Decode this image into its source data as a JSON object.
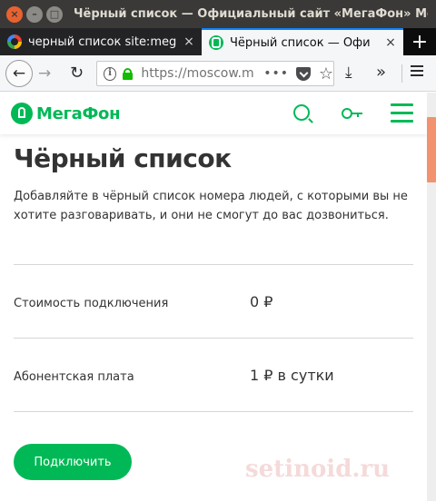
{
  "window": {
    "title": "Чёрный список — Официальный сайт «МегаФон» Мо",
    "close_glyph": "×",
    "minimize_glyph": "–",
    "maximize_glyph": "□"
  },
  "tabs": [
    {
      "label": "черный список site:meg",
      "favicon": "google-favicon",
      "close_glyph": "×",
      "active": false
    },
    {
      "label": "Чёрный список — Офи",
      "favicon": "megafon-favicon",
      "close_glyph": "×",
      "active": true
    }
  ],
  "new_tab_glyph": "+",
  "nav": {
    "back_glyph": "←",
    "forward_glyph": "→",
    "reload_glyph": "↻",
    "info_glyph": "i",
    "url": "https://moscow.m",
    "more_glyph": "•••",
    "star_glyph": "☆",
    "download_glyph": "⤓",
    "overflow_glyph": "»"
  },
  "site": {
    "logo_text": "МегаФон",
    "brand_color": "#00b956"
  },
  "main": {
    "title": "Чёрный список",
    "description": "Добавляйте в чёрный список номера людей, с которыми вы не хотите разговаривать, и они не смогут до вас дозвониться.",
    "rows": [
      {
        "label": "Стоимость подключения",
        "value": "0 ₽"
      },
      {
        "label": "Абонентская плата",
        "value": "1 ₽ в сутки"
      }
    ],
    "connect_button": "Подключить"
  },
  "watermark": "setinoid.ru",
  "colors": {
    "accent": "#00b956",
    "titlebar": "#3a3937",
    "tabbar": "#0c0c0d",
    "scroll_thumb": "#f2926e"
  }
}
